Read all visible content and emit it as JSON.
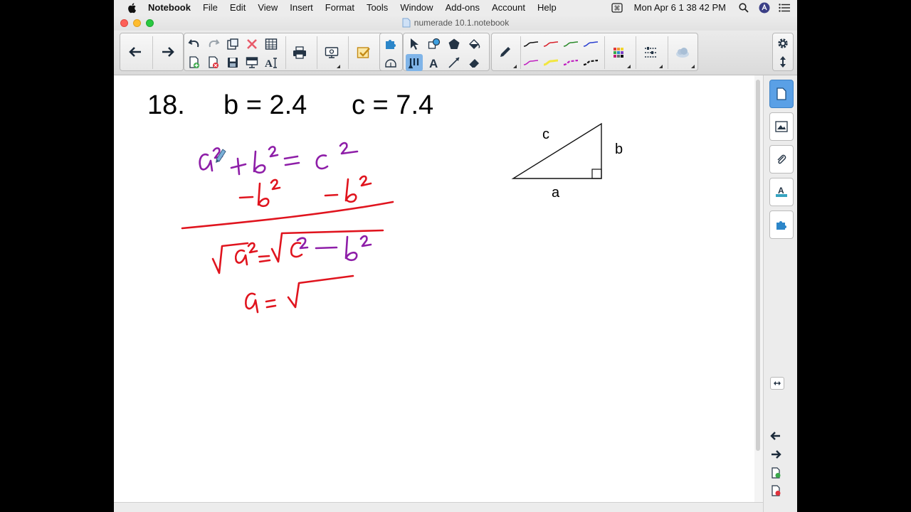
{
  "menubar": {
    "app_name": "Notebook",
    "items": [
      "File",
      "Edit",
      "View",
      "Insert",
      "Format",
      "Tools",
      "Window",
      "Add-ons",
      "Account",
      "Help"
    ],
    "datetime": "Mon Apr 6  1 38 42 PM"
  },
  "window": {
    "title": "numerade 10.1.notebook"
  },
  "toolbar": {
    "icons": [
      "back-arrow",
      "forward-arrow",
      "undo",
      "redo",
      "paste",
      "delete",
      "table",
      "add-page",
      "delete-page",
      "save",
      "screen-shade",
      "handwriting",
      "print",
      "display",
      "response",
      "add-ons",
      "measure",
      "select",
      "shapes",
      "fill",
      "pen",
      "text",
      "line",
      "eraser",
      "pen-style",
      "pen-color-black",
      "pen-color-red",
      "pen-color-green",
      "pen-color-blue",
      "pen-color-magenta",
      "pen-color-yellow",
      "pen-color-magenta-dashed",
      "pen-color-black-dashed",
      "color-grid",
      "properties",
      "toolbar-more"
    ],
    "colors": {
      "pen_black": "#111111",
      "pen_red": "#d8202a",
      "pen_green": "#2a8a2a",
      "pen_blue": "#2a3fd0",
      "pen_magenta": "#c020c0",
      "pen_yellow": "#f2e640",
      "accent_active": "#7fb4e8"
    }
  },
  "page": {
    "problem_number": "18.",
    "given_b": "b = 2.4",
    "given_c": "c = 7.4",
    "triangle": {
      "label_hyp": "c",
      "label_vertical": "b",
      "label_base": "a"
    },
    "ink_colors": {
      "purple": "#8e1ea8",
      "red": "#e0141e"
    }
  },
  "sidebar": {
    "tabs": [
      "page-sorter",
      "gallery",
      "attachments",
      "properties",
      "add-ons"
    ],
    "active_tab": "page-sorter"
  }
}
